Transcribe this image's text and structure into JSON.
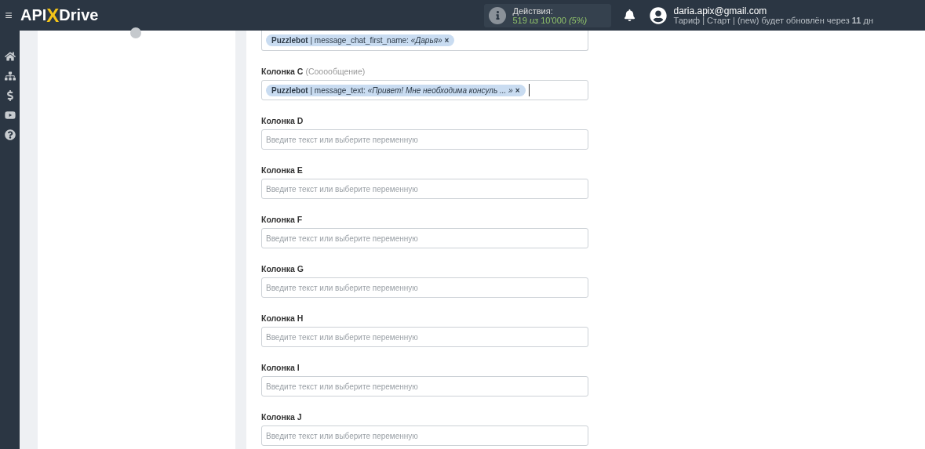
{
  "header": {
    "menu": "≡",
    "logo": {
      "left": "API",
      "mark": "X",
      "right": "Drive"
    },
    "actions": {
      "label": "Действия:",
      "value": "519 *из* 10'000 *(5%)*"
    },
    "user": {
      "email": "daria.apix@gmail.com",
      "plan": "Тариф | Старт | (new) будет обновлён через **11** дн"
    }
  },
  "fields": [
    {
      "tags": [
        {
          "text": "**Puzzlebot** | message_chat_first_name: *«Дарья»*",
          "remove": "×"
        }
      ]
    },
    {
      "label": "Колонка C",
      "hint": "(Сооообщение)",
      "tags": [
        {
          "text": "**Puzzlebot** | message_text: *«Привет! Мне необходима консуль ... »*",
          "remove": "×"
        }
      ],
      "cursor": true
    },
    {
      "label": "Колонка D",
      "placeholder": "Введите текст или выберите переменную"
    },
    {
      "label": "Колонка E",
      "placeholder": "Введите текст или выберите переменную"
    },
    {
      "label": "Колонка F",
      "placeholder": "Введите текст или выберите переменную"
    },
    {
      "label": "Колонка G",
      "placeholder": "Введите текст или выберите переменную"
    },
    {
      "label": "Колонка H",
      "placeholder": "Введите текст или выберите переменную"
    },
    {
      "label": "Колонка I",
      "placeholder": "Введите текст или выберите переменную"
    },
    {
      "label": "Колонка J",
      "placeholder": "Введите текст или выберите переменную"
    }
  ]
}
